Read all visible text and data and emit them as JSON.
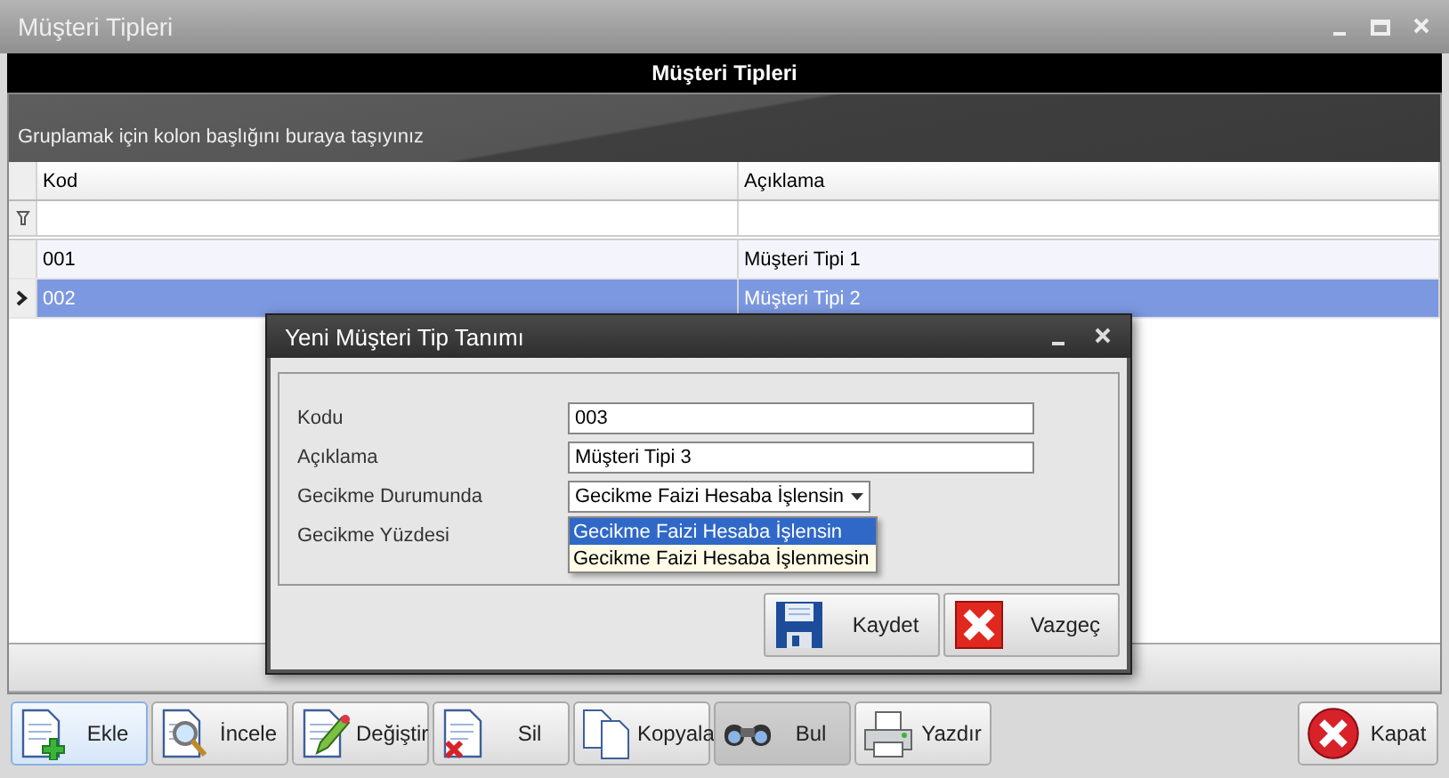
{
  "window": {
    "title": "Müşteri Tipleri",
    "header": "Müşteri Tipleri"
  },
  "group_panel": {
    "hint": "Gruplamak için kolon başlığını buraya taşıyınız"
  },
  "grid": {
    "columns": [
      "Kod",
      "Açıklama"
    ],
    "rows": [
      {
        "cells": [
          "001",
          "Müşteri Tipi 1"
        ],
        "selected": false
      },
      {
        "cells": [
          "002",
          "Müşteri Tipi 2"
        ],
        "selected": true
      }
    ]
  },
  "dialog": {
    "title": "Yeni Müşteri Tip Tanımı",
    "fields": [
      {
        "label": "Kodu",
        "kind": "text",
        "value": "003"
      },
      {
        "label": "Açıklama",
        "kind": "text",
        "value": "Müşteri Tipi 3"
      },
      {
        "label": "Gecikme Durumunda",
        "kind": "select",
        "value": "Gecikme Faizi Hesaba İşlensin",
        "expanded": true,
        "options": [
          {
            "label": "Gecikme Faizi Hesaba İşlensin",
            "selected": true
          },
          {
            "label": "Gecikme Faizi Hesaba İşlenmesin",
            "selected": false
          }
        ]
      },
      {
        "label": "Gecikme Yüzdesi",
        "kind": "covered"
      }
    ],
    "buttons": [
      {
        "label": "Kaydet",
        "kind": "save"
      },
      {
        "label": "Vazgeç",
        "kind": "cancel"
      }
    ]
  },
  "toolbar": {
    "buttons": [
      {
        "label": "Ekle",
        "kind": "add",
        "focused": true,
        "pressed": false
      },
      {
        "label": "İncele",
        "kind": "view",
        "focused": false,
        "pressed": false
      },
      {
        "label": "Değiştir",
        "kind": "edit",
        "focused": false,
        "pressed": false
      },
      {
        "label": "Sil",
        "kind": "delete",
        "focused": false,
        "pressed": false
      },
      {
        "label": "Kopyala",
        "kind": "copy",
        "focused": false,
        "pressed": false
      },
      {
        "label": "Bul",
        "kind": "find",
        "focused": false,
        "pressed": true
      },
      {
        "label": "Yazdır",
        "kind": "print",
        "focused": false,
        "pressed": false
      }
    ],
    "close": {
      "label": "Kapat",
      "kind": "close"
    }
  }
}
